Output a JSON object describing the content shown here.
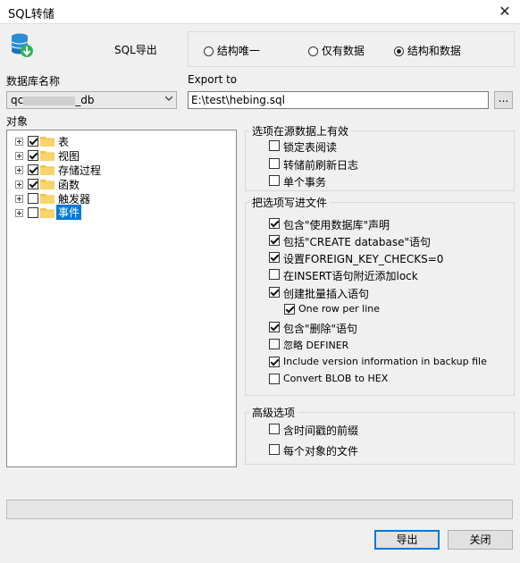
{
  "window": {
    "title": "SQL转储"
  },
  "export_mode": {
    "label": "SQL导出",
    "options": [
      {
        "label": "结构唯一",
        "selected": false
      },
      {
        "label": "仅有数据",
        "selected": false
      },
      {
        "label": "结构和数据",
        "selected": true
      }
    ]
  },
  "database": {
    "label": "数据库名称",
    "value_prefix": "qc",
    "value_suffix": "_db"
  },
  "export_to": {
    "label": "Export to",
    "value": "E:\\test\\hebing.sql",
    "browse_label": "..."
  },
  "objects": {
    "label": "对象",
    "items": [
      {
        "label": "表",
        "checked": true
      },
      {
        "label": "视图",
        "checked": true
      },
      {
        "label": "存储过程",
        "checked": true
      },
      {
        "label": "函数",
        "checked": true
      },
      {
        "label": "触发器",
        "checked": false
      },
      {
        "label": "事件",
        "checked": false,
        "selected": true
      }
    ]
  },
  "source_options": {
    "title": "选项在源数据上有效",
    "items": [
      {
        "label": "锁定表阅读",
        "checked": false
      },
      {
        "label": "转储前刷新日志",
        "checked": false
      },
      {
        "label": "单个事务",
        "checked": false
      }
    ]
  },
  "file_options": {
    "title": "把选项写进文件",
    "items": [
      {
        "label": "包含\"使用数据库\"声明",
        "checked": true
      },
      {
        "label": "包括\"CREATE database\"语句",
        "checked": true
      },
      {
        "label": "设置FOREIGN_KEY_CHECKS=0",
        "checked": true
      },
      {
        "label": "在INSERT语句附近添加lock",
        "checked": false
      },
      {
        "label": "创建批量插入语句",
        "checked": true
      },
      {
        "label": "One row per line",
        "checked": true
      },
      {
        "label": "包含\"删除\"语句",
        "checked": true
      },
      {
        "label": "忽略 DEFINER",
        "checked": false
      },
      {
        "label": "Include version information in backup file",
        "checked": true
      },
      {
        "label": "Convert BLOB to HEX",
        "checked": false
      }
    ]
  },
  "advanced_options": {
    "title": "高级选项",
    "items": [
      {
        "label": "含时间戳的前缀",
        "checked": false
      },
      {
        "label": "每个对象的文件",
        "checked": false
      }
    ]
  },
  "progress": {
    "value": 0
  },
  "buttons": {
    "export": "导出",
    "close": "关闭"
  },
  "colors": {
    "selection": "#0078d7",
    "folder": "#f5c342"
  }
}
